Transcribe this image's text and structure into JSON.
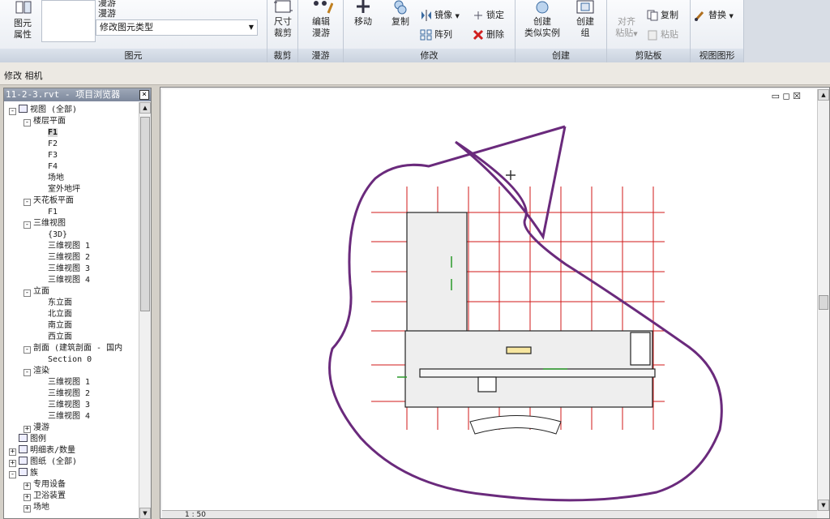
{
  "ribbon": {
    "properties_label": "图元\n属性",
    "walk_line1": "漫游",
    "walk_line2": "漫游",
    "type_selector": "修改图元类型",
    "panels": {
      "element": "图元",
      "crop": "裁剪",
      "walkthrough": "漫游",
      "modify": "修改",
      "create": "创建",
      "clipboard": "剪贴板",
      "view_graphics": "视图图形"
    },
    "buttons": {
      "crop_size": "尺寸\n裁剪",
      "edit_walk": "编辑\n漫游",
      "move": "移动",
      "copy": "复制",
      "mirror": "镜像",
      "array": "阵列",
      "lock": "锁定",
      "delete": "删除",
      "create_similar": "创建\n类似实例",
      "create_group": "创建\n组",
      "align_paste": "对齐\n粘贴",
      "clip_copy": "复制",
      "paste": "粘贴",
      "replace": "替换"
    }
  },
  "options_bar": "修改 相机",
  "browser": {
    "title": "11-2-3.rvt - 项目浏览器",
    "close": "×",
    "tree": [
      {
        "label": "视图 (全部)",
        "indent": 0,
        "toggle": "-",
        "icon": true
      },
      {
        "label": "楼层平面",
        "indent": 1,
        "toggle": "-"
      },
      {
        "label": "F1",
        "indent": 2,
        "selected": true
      },
      {
        "label": "F2",
        "indent": 2
      },
      {
        "label": "F3",
        "indent": 2
      },
      {
        "label": "F4",
        "indent": 2
      },
      {
        "label": "场地",
        "indent": 2
      },
      {
        "label": "室外地坪",
        "indent": 2
      },
      {
        "label": "天花板平面",
        "indent": 1,
        "toggle": "-"
      },
      {
        "label": "F1",
        "indent": 2
      },
      {
        "label": "三维视图",
        "indent": 1,
        "toggle": "-"
      },
      {
        "label": "{3D}",
        "indent": 2
      },
      {
        "label": "三维视图 1",
        "indent": 2
      },
      {
        "label": "三维视图 2",
        "indent": 2
      },
      {
        "label": "三维视图 3",
        "indent": 2
      },
      {
        "label": "三维视图 4",
        "indent": 2
      },
      {
        "label": "立面",
        "indent": 1,
        "toggle": "-"
      },
      {
        "label": "东立面",
        "indent": 2
      },
      {
        "label": "北立面",
        "indent": 2
      },
      {
        "label": "南立面",
        "indent": 2
      },
      {
        "label": "西立面",
        "indent": 2
      },
      {
        "label": "剖面 (建筑剖面 - 国内",
        "indent": 1,
        "toggle": "-"
      },
      {
        "label": "Section 0",
        "indent": 2
      },
      {
        "label": "渲染",
        "indent": 1,
        "toggle": "-"
      },
      {
        "label": "三维视图 1",
        "indent": 2
      },
      {
        "label": "三维视图 2",
        "indent": 2
      },
      {
        "label": "三维视图 3",
        "indent": 2
      },
      {
        "label": "三维视图 4",
        "indent": 2
      },
      {
        "label": "漫游",
        "indent": 1,
        "toggle": "+"
      },
      {
        "label": "图例",
        "indent": 0,
        "icon": true
      },
      {
        "label": "明细表/数量",
        "indent": 0,
        "toggle": "+",
        "icon": true
      },
      {
        "label": "图纸 (全部)",
        "indent": 0,
        "toggle": "+",
        "icon": true
      },
      {
        "label": "族",
        "indent": 0,
        "toggle": "-",
        "icon": true
      },
      {
        "label": "专用设备",
        "indent": 1,
        "toggle": "+"
      },
      {
        "label": "卫浴装置",
        "indent": 1,
        "toggle": "+"
      },
      {
        "label": "场地",
        "indent": 1,
        "toggle": "+"
      }
    ]
  },
  "canvas": {
    "window_controls": "▭ ◻ ☒",
    "viewbar_scale": "1 : 50"
  },
  "colors": {
    "grid_line": "#d01818",
    "annotation": "#6a2a7c",
    "ribbon_bg": "#eef1f6",
    "title_bar": "#8a95a8"
  }
}
